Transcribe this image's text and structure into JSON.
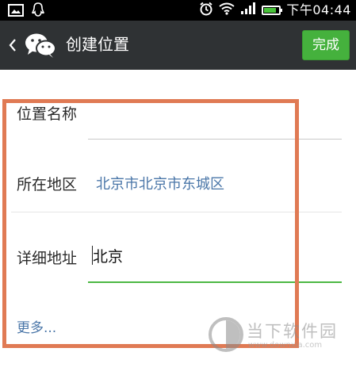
{
  "status_bar": {
    "time": "下午04:44",
    "battery_level": 0.85
  },
  "header": {
    "title": "创建位置",
    "done_label": "完成"
  },
  "form": {
    "name_label": "位置名称",
    "name_value": "",
    "region_label": "所在地区",
    "region_value": "北京市北京市东城区",
    "detail_label": "详细地址",
    "detail_value": "北京",
    "more_label": "更多..."
  },
  "watermark": {
    "text": "当下软件园",
    "url": "www.downxia.com"
  },
  "colors": {
    "title_bar": "#2f3234",
    "done_button": "#45b13d",
    "highlight_border": "#e07a54",
    "link_blue": "#4a76a8"
  }
}
